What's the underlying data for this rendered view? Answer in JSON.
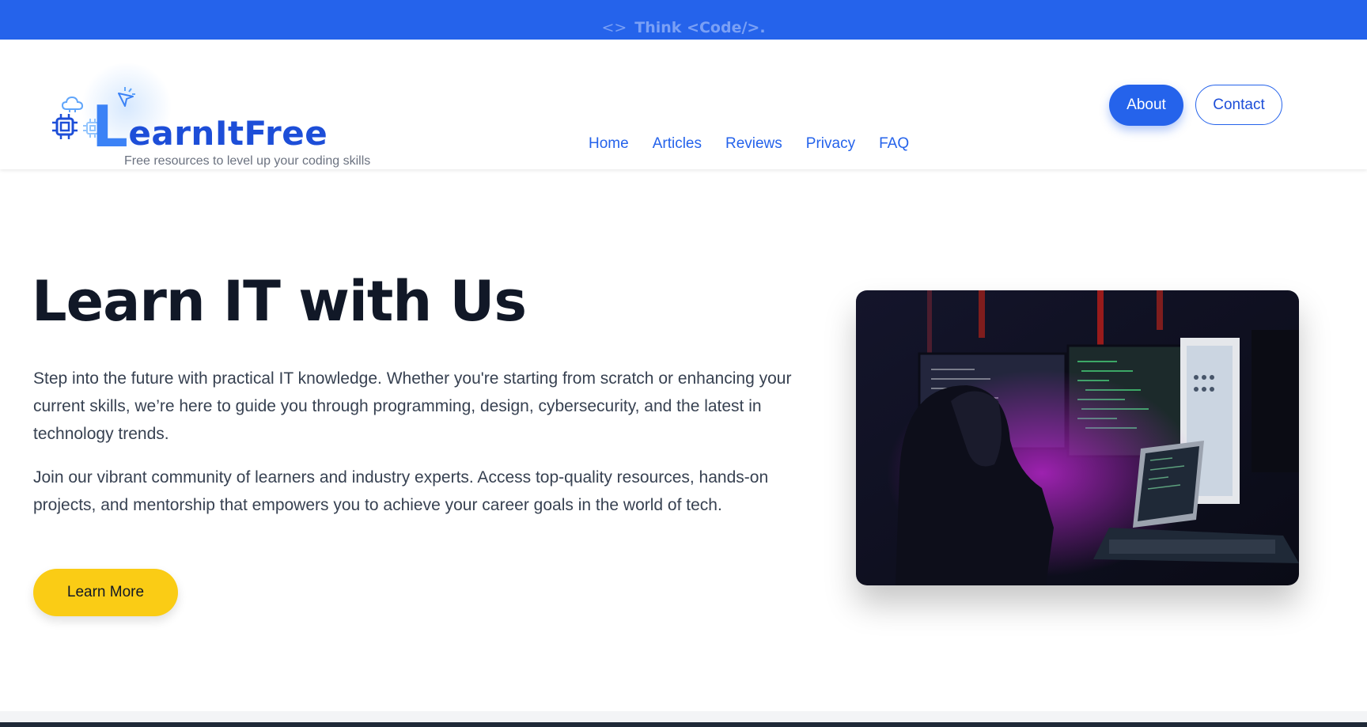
{
  "topbar": {
    "code_icon": "<>",
    "text": "Think <Code/>."
  },
  "brand": {
    "name": "earnItFree",
    "initial": "L",
    "tagline": "Free resources to level up your coding skills",
    "icons": [
      "chip-icon",
      "cloud-icon",
      "sparkle-icon"
    ]
  },
  "nav": {
    "items": [
      {
        "label": "Home"
      },
      {
        "label": "Articles"
      },
      {
        "label": "Reviews"
      },
      {
        "label": "Privacy"
      },
      {
        "label": "FAQ"
      }
    ],
    "about_label": "About",
    "contact_label": "Contact"
  },
  "hero": {
    "title": "Learn IT with Us",
    "paragraph1": "Step into the future with practical IT knowledge. Whether you're starting from scratch or enhancing your current skills, we’re here to guide you through programming, design, cybersecurity, and the latest in technology trends.",
    "paragraph2": "Join our vibrant community of learners and industry experts. Access top-quality resources, hands-on projects, and mentorship that empowers you to achieve your career goals in the world of tech.",
    "cta_label": "Learn More",
    "image": "hooded-coder-at-computer-setup-photo"
  },
  "colors": {
    "primary": "#2563eb",
    "accent": "#facc15",
    "heading": "#111827",
    "body_text": "#374151"
  }
}
